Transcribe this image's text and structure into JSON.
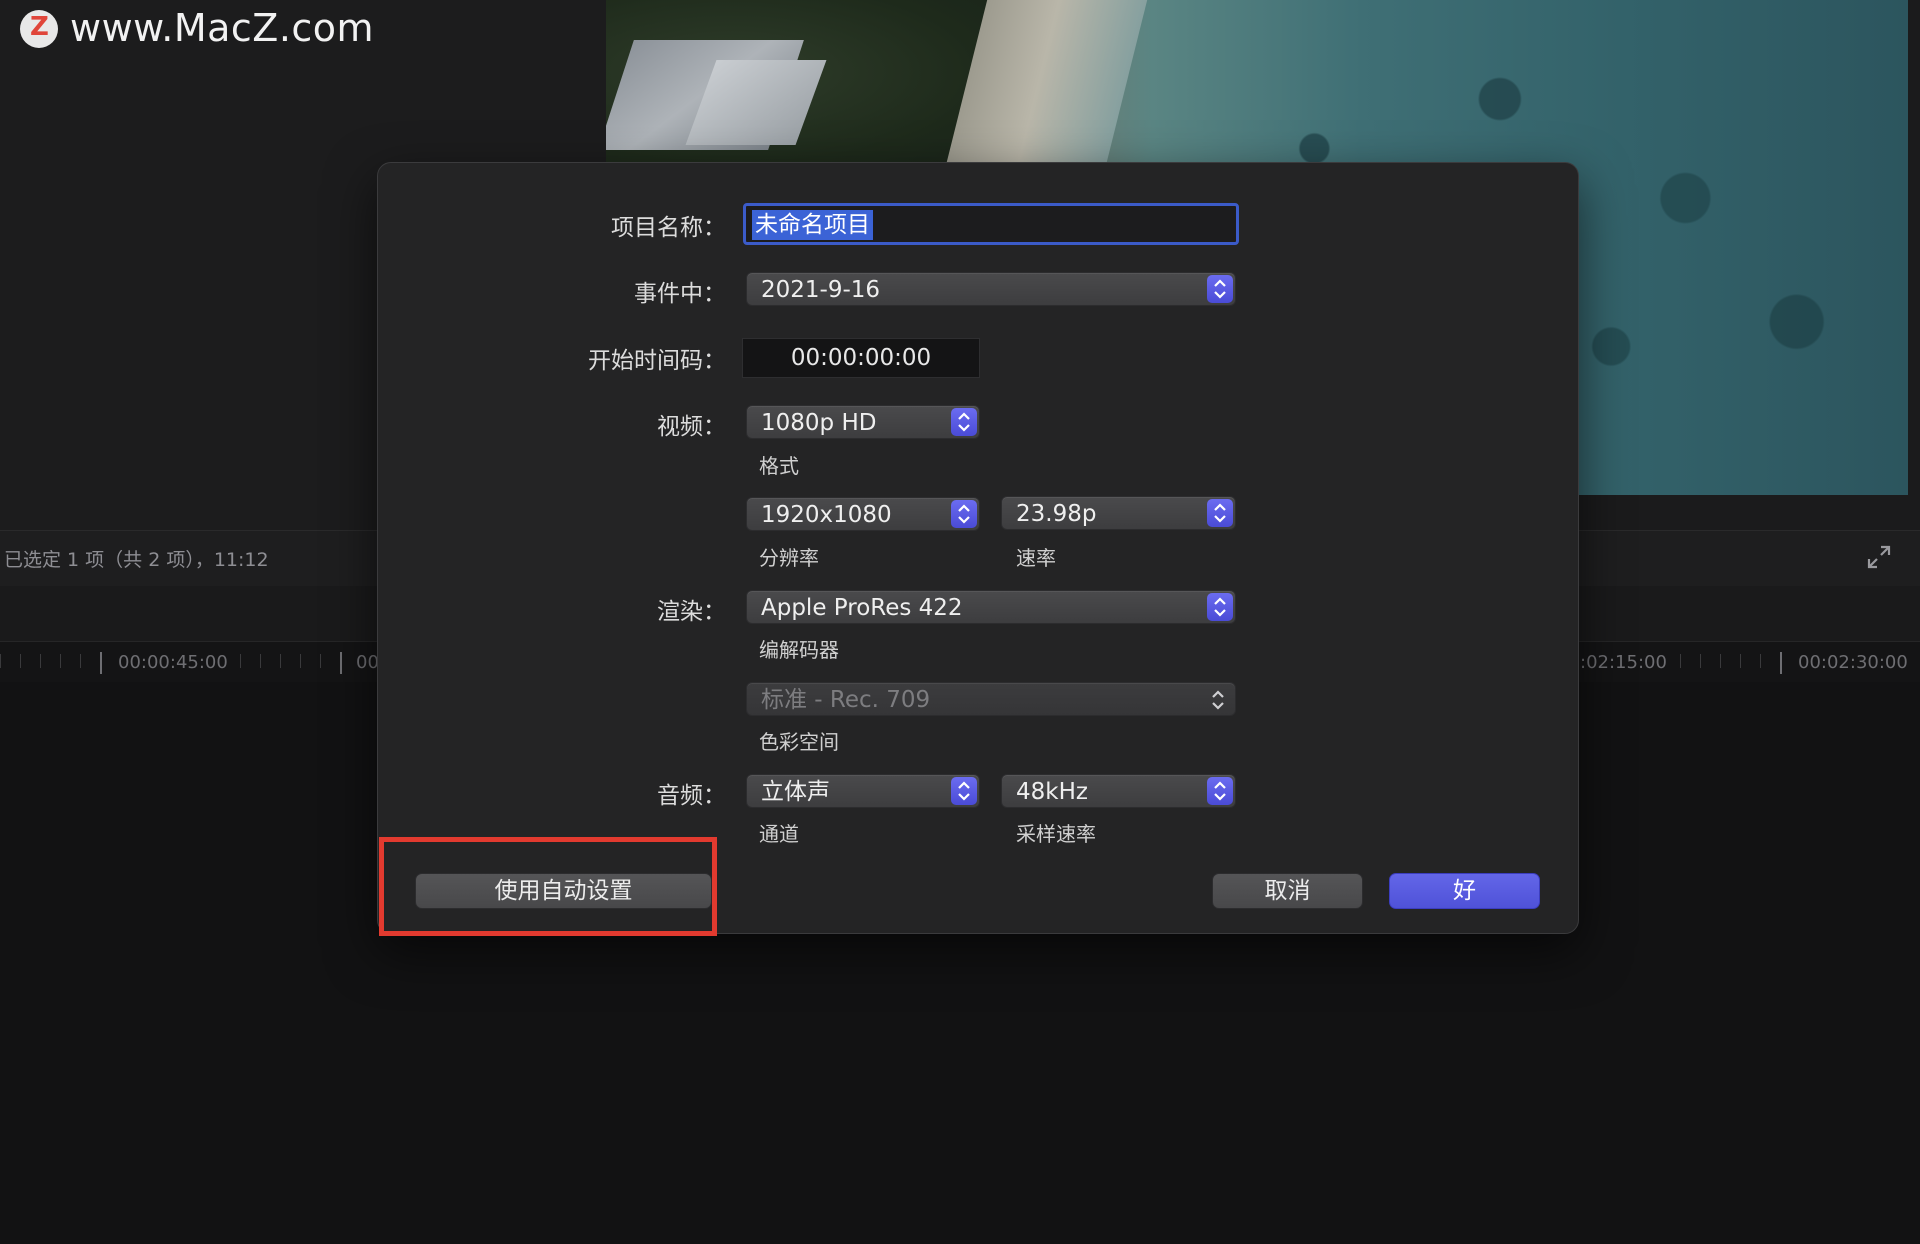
{
  "watermark": {
    "text": "www.MacZ.com",
    "logo_letter": "Z",
    "logo_color": "#e0453a"
  },
  "browser_status": {
    "text": "已选定 1 项（共 2 项），11:12"
  },
  "timeline": {
    "timecodes": [
      "00:00:45:00",
      "00",
      ":02:15:00",
      "00:02:30:00"
    ]
  },
  "dialog": {
    "project_name": {
      "label": "项目名称：",
      "value": "未命名项目"
    },
    "event": {
      "label": "事件中：",
      "value": "2021-9-16"
    },
    "start_timecode": {
      "label": "开始时间码：",
      "value": "00:00:00:00"
    },
    "video": {
      "label": "视频：",
      "format": {
        "value": "1080p HD",
        "caption": "格式"
      },
      "resolution": {
        "value": "1920x1080",
        "caption": "分辨率"
      },
      "rate": {
        "value": "23.98p",
        "caption": "速率"
      }
    },
    "rendering": {
      "label": "渲染：",
      "codec": {
        "value": "Apple ProRes 422",
        "caption": "编解码器"
      },
      "color_space": {
        "value": "标准 - Rec. 709",
        "caption": "色彩空间"
      }
    },
    "audio": {
      "label": "音频：",
      "channels": {
        "value": "立体声",
        "caption": "通道"
      },
      "sample_rate": {
        "value": "48kHz",
        "caption": "采样速率"
      }
    },
    "buttons": {
      "auto_settings": "使用自动设置",
      "cancel": "取消",
      "ok": "好"
    }
  },
  "colors": {
    "accent": "#5a5ce0",
    "highlight_box": "#e23a2f",
    "selection": "#3b63d6"
  }
}
